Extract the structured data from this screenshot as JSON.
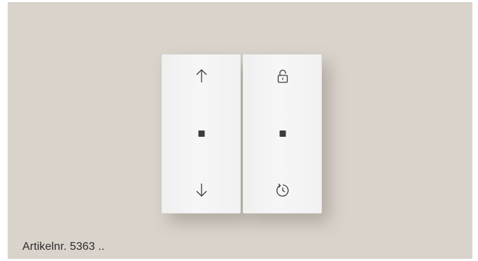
{
  "product": {
    "caption": "Artikelnr. 5363 .."
  },
  "switch": {
    "left_rocker": {
      "top_icon": "arrow-up-icon",
      "middle_indicator": "status-led",
      "bottom_icon": "arrow-down-icon"
    },
    "right_rocker": {
      "top_icon": "unlock-icon",
      "middle_indicator": "status-led",
      "bottom_icon": "timer-icon"
    }
  },
  "colors": {
    "background": "#d9d3cb",
    "rocker": "#f2f2f2",
    "icon": "#3a3a3a",
    "led": "#3c3c3c"
  }
}
